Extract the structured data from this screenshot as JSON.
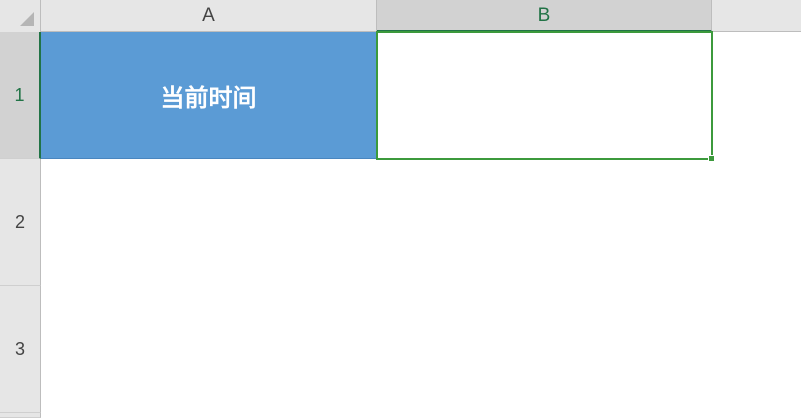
{
  "sheet": {
    "columns": [
      "A",
      "B"
    ],
    "rows": [
      "1",
      "2",
      "3"
    ],
    "cells": {
      "A1": "当前时间",
      "B1": ""
    },
    "selected_cell": "B1",
    "colors": {
      "header_bg": "#e6e6e6",
      "selected_accent": "#217346",
      "selection_border": "#3c9a3c",
      "a1_fill": "#5b9bd5",
      "a1_text": "#ffffff"
    }
  }
}
